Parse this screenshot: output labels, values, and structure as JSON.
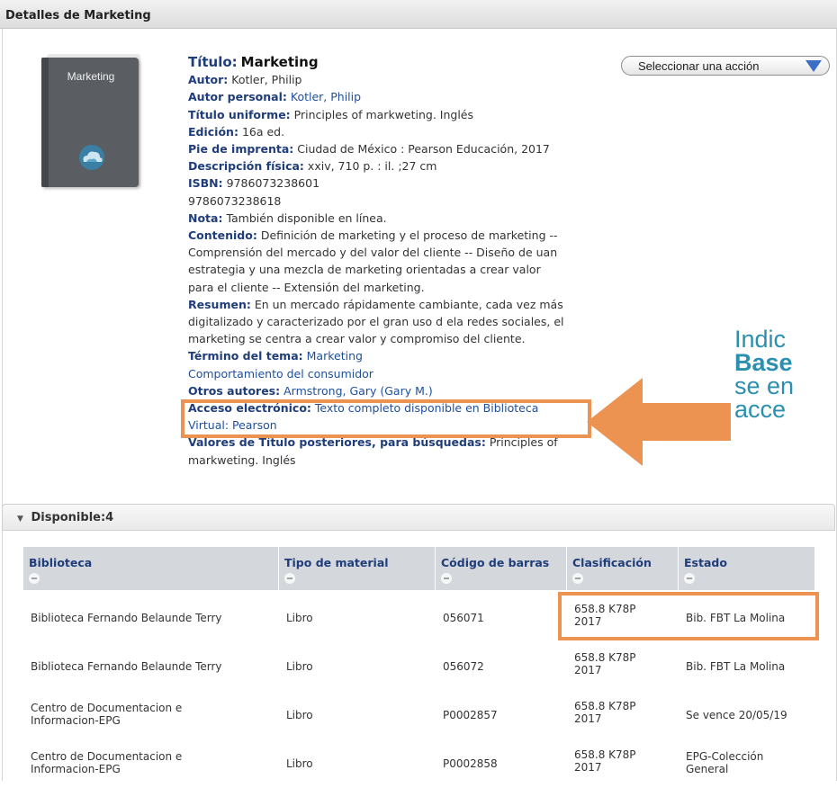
{
  "panel": {
    "title": "Detalles de Marketing"
  },
  "book_thumb": {
    "cover_title": "Marketing",
    "icon": "cloud-icon"
  },
  "actions": {
    "select_label": "Seleccionar una acción",
    "icon": "chevron-down-icon"
  },
  "record": {
    "titulo": {
      "label": "Título:",
      "value": "Marketing"
    },
    "autor": {
      "label": "Autor:",
      "value": "Kotler, Philip"
    },
    "autor_personal": {
      "label": "Autor personal:",
      "value": "Kotler, Philip"
    },
    "titulo_uniforme": {
      "label": "Título uniforme:",
      "value": "Principles of markweting. Inglés"
    },
    "edicion": {
      "label": "Edición:",
      "value": "16a ed."
    },
    "pie_imprenta": {
      "label": "Pie de imprenta:",
      "value": "Ciudad de México : Pearson Educación, 2017"
    },
    "descripcion": {
      "label": "Descripción física:",
      "value": "xxiv, 710 p. : il. ;27 cm"
    },
    "isbn": {
      "label": "ISBN:",
      "value": "9786073238601",
      "value2": "9786073238618"
    },
    "nota": {
      "label": "Nota:",
      "value": "También disponible en línea."
    },
    "contenido": {
      "label": "Contenido:",
      "lines": [
        "Definición de marketing y el proceso de marketing --",
        "Comprensión del mercado y del valor del cliente -- Diseño de uan",
        "estrategia y una mezcla de marketing orientadas a crear valor",
        "para el cliente -- Extensión del marketing."
      ]
    },
    "resumen": {
      "label": "Resumen:",
      "lines": [
        "En un mercado rápidamente cambiante, cada vez más",
        "digitalizado y caracterizado por el gran uso d ela redes sociales, el",
        "marketing se centra a crear valor y compromiso del cliente."
      ]
    },
    "termino": {
      "label": "Término del tema:",
      "value": "Marketing",
      "value2": "Comportamiento del consumidor"
    },
    "otros_autores": {
      "label": "Otros autores:",
      "value": "Armstrong, Gary (Gary M.)"
    },
    "acceso": {
      "label": "Acceso electrónico:",
      "value": "Texto completo disponible en Biblioteca",
      "value2": "Virtual: Pearson"
    },
    "valores": {
      "label": "Valores de Título posteriores, para búsquedas:",
      "value": "Principles of",
      "value2": "markweting. Inglés"
    }
  },
  "annotation": {
    "line1": "Indic",
    "line2": "Base",
    "line3": "se en",
    "line4": "acce"
  },
  "availability": {
    "label": "Disponible:4",
    "columns": [
      "Biblioteca",
      "Tipo de material",
      "Código de barras",
      "Clasificación",
      "Estado"
    ],
    "rows": [
      {
        "biblioteca": "Biblioteca Fernando Belaunde Terry",
        "tipo": "Libro",
        "codigo": "056071",
        "clasif1": "658.8 K78P",
        "clasif2": "2017",
        "estado": "Bib. FBT La Molina",
        "estado2": ""
      },
      {
        "biblioteca": "Biblioteca Fernando Belaunde Terry",
        "tipo": "Libro",
        "codigo": "056072",
        "clasif1": "658.8 K78P",
        "clasif2": "2017",
        "estado": "Bib. FBT La Molina",
        "estado2": ""
      },
      {
        "biblioteca": "Centro de Documentacion e",
        "biblioteca2": "Informacion-EPG",
        "tipo": "Libro",
        "codigo": "P0002857",
        "clasif1": "658.8 K78P",
        "clasif2": "2017",
        "estado": "Se vence 20/05/19",
        "estado2": ""
      },
      {
        "biblioteca": "Centro de Documentacion e",
        "biblioteca2": "Informacion-EPG",
        "tipo": "Libro",
        "codigo": "P0002858",
        "clasif1": "658.8 K78P",
        "clasif2": "2017",
        "estado": "EPG-Colección",
        "estado2": "General"
      }
    ]
  },
  "colors": {
    "label_blue": "#1f3d7a",
    "link_blue": "#1f4f9c",
    "highlight_orange": "#ec9351",
    "annotation_teal": "#2a8fb0"
  }
}
